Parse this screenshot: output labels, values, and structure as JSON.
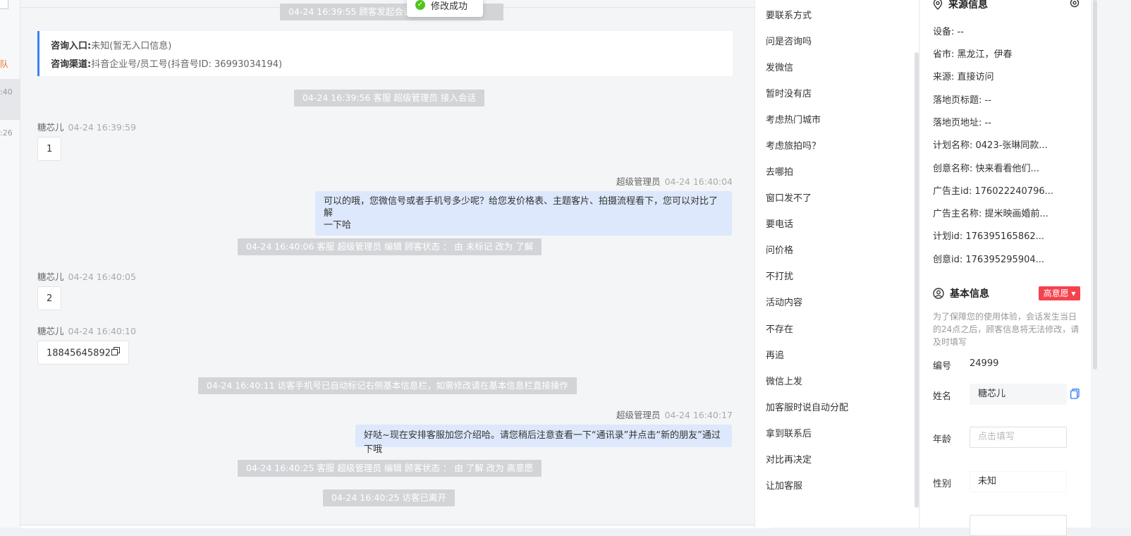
{
  "left": {
    "s1": "队",
    "s2": ":40",
    "s3": ":26"
  },
  "toast": {
    "text": "修改成功"
  },
  "chat": {
    "sys_top": "04-24 16:39:55 顾客发起会话",
    "info": {
      "entry_label": "咨询入口:",
      "entry_value": "未知(暂无入口信息)",
      "channel_label": "咨询渠道:",
      "channel_value": "抖音企业号/员工号(抖音号ID: 36993034194)"
    },
    "sys1": "04-24 16:39:56 客服 超级管理员 接入会话",
    "m1": {
      "name": "糖芯儿",
      "time": "04-24 16:39:59",
      "text": "1"
    },
    "m2": {
      "name": "超级管理员",
      "time": "04-24 16:40:04",
      "line1": "可以的哦，您微信号或者手机号多少呢？给您发价格表、主题客片、拍摄流程看下，您可以对比了解",
      "line2": "一下哈"
    },
    "sys2": "04-24 16:40:06 客服 超级管理员 编辑 顾客状态 ： 由 未标记 改为 了解",
    "m3": {
      "name": "糖芯儿",
      "time": "04-24 16:40:05",
      "text": "2"
    },
    "m4": {
      "name": "糖芯儿",
      "time": "04-24 16:40:10",
      "text": "18845645892"
    },
    "sys3": "04-24 16:40:11 访客手机号已自动标记右侧基本信息栏，如需修改请在基本信息栏直接操作",
    "m5": {
      "name": "超级管理员",
      "time": "04-24 16:40:17",
      "text": "好哒~现在安排客服加您介绍哈。请您稍后注意查看一下“通讯录”并点击“新的朋友”通过下哦"
    },
    "sys4": "04-24 16:40:25 客服 超级管理员 编辑 顾客状态 ： 由 了解 改为 高意愿",
    "sys5": "04-24 16:40:25 访客已离开"
  },
  "quick_replies": [
    "要联系方式",
    "问是咨询吗",
    "发微信",
    "暂时没有店",
    "考虑热门城市",
    "考虑旅拍吗？",
    "去哪拍",
    "窗口发不了",
    "要电话",
    "问价格",
    "不打扰",
    "活动内容",
    "不存在",
    "再追",
    "微信上发",
    "加客服时说自动分配",
    "拿到联系后",
    "对比再决定",
    "让加客服"
  ],
  "source": {
    "title": "来源信息",
    "lines": [
      "设备: --",
      "省市: 黑龙江，伊春",
      "来源: 直接访问",
      "落地页标题: --",
      "落地页地址: --",
      "计划名称: 0423-张琳同款...",
      "创意名称: 快来看看他们...",
      "广告主id: 176022240796...",
      "广告主名称: 提米映画婚前...",
      "计划id: 176395165862...",
      "创意id: 176395295904..."
    ]
  },
  "basic": {
    "title": "基本信息",
    "badge": "高意愿 ▾",
    "tip": "为了保障您的使用体验，会话发生当日的24点之后，顾客信息将无法修改，请及时填写",
    "id_label": "编号",
    "id_value": "24999",
    "name_label": "姓名",
    "name_value": "糖芯儿",
    "age_label": "年龄",
    "age_placeholder": "点击填写",
    "gender_label": "性别",
    "gender_value": "未知"
  },
  "colors": {
    "accent": "#3b82f6",
    "badge": "#f5424d",
    "bubble_right": "#dde8fc",
    "sys": "#d3d4d8"
  }
}
